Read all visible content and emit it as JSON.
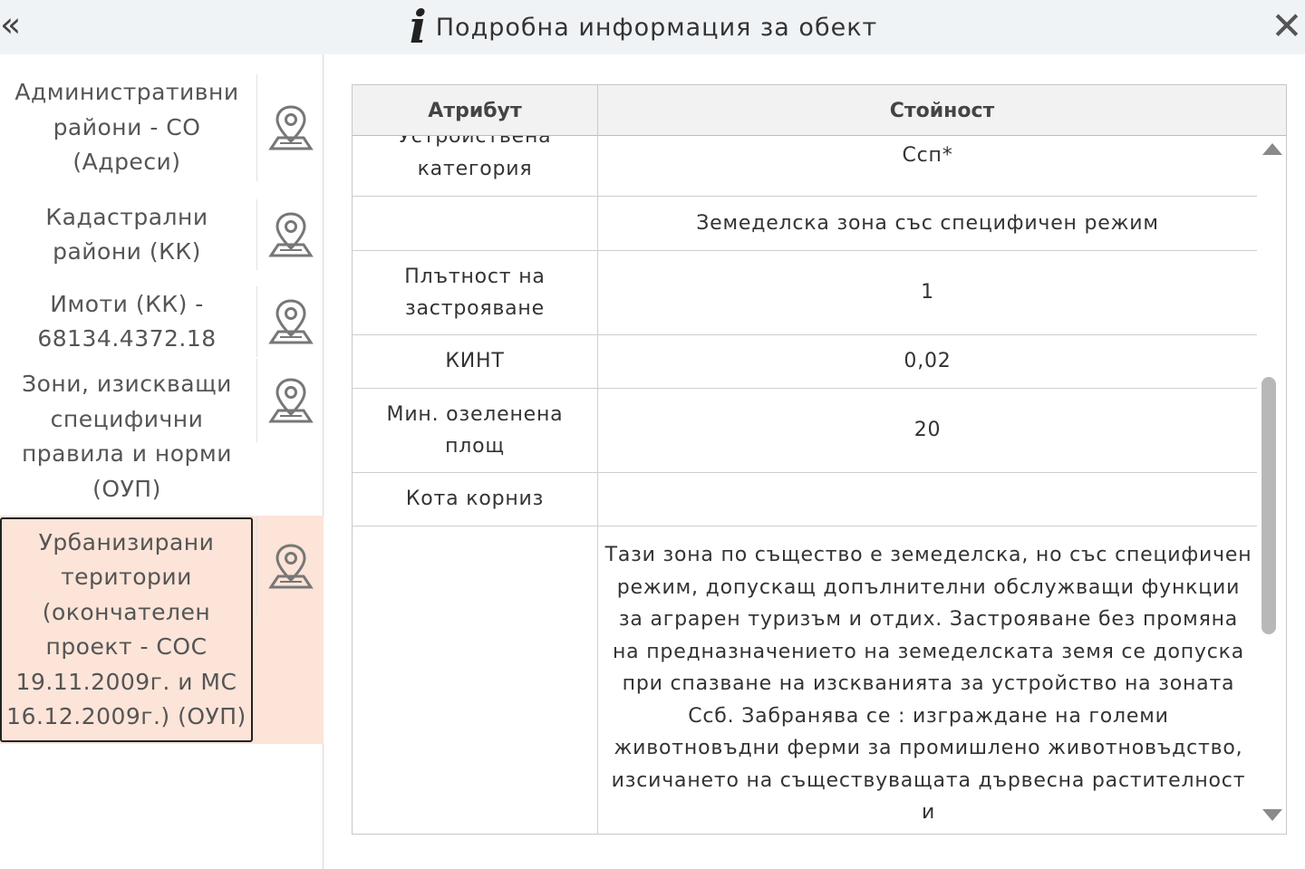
{
  "header": {
    "collapse_glyph": "«",
    "info_glyph": "i",
    "title": "Подробна информация за обект",
    "close_glyph": "✕"
  },
  "layers": [
    {
      "label": "Административни райони - СО (Адреси)",
      "icon": "map-pin-icon",
      "selected": false
    },
    {
      "label": "Кадастрални райони (КК)",
      "icon": "map-pin-icon",
      "selected": false
    },
    {
      "label": "Имоти (КК) - 68134.4372.18",
      "icon": "map-pin-icon",
      "selected": false
    },
    {
      "label": "Зони, изискващи специфични правила и норми (ОУП)",
      "icon": "map-pin-icon",
      "selected": false
    },
    {
      "label": "Урбанизирани територии (окончателен проект - СОС 19.11.2009г. и МС 16.12.2009г.) (ОУП)",
      "icon": "map-pin-icon",
      "selected": true
    }
  ],
  "table": {
    "columns": {
      "attribute": "Атрибут",
      "value": "Стойност"
    },
    "rows": [
      {
        "attribute": "Устройствена категория",
        "value": "Ссп*"
      },
      {
        "attribute": "",
        "value": "Земеделска зона със специфичен режим"
      },
      {
        "attribute": "Плътност на застрояване",
        "value": "1"
      },
      {
        "attribute": "КИНТ",
        "value": "0,02"
      },
      {
        "attribute": "Мин. озеленена площ",
        "value": "20"
      },
      {
        "attribute": "Кота корниз",
        "value": ""
      },
      {
        "attribute": "",
        "value": "Тази зона по същество е земеделска, но със специфичен режим, допускащ допълнителни обслужващи функции за аграрен туризъм и отдих. Застрояване без промяна на предназначението на земеделската земя се допуска при спазване на изскванията за устройство на зоната Ссб. Забранява се : изграждане на големи животновъдни ферми за промишлено животновъдство, изсичането на съществуващата дървесна растителност и"
      }
    ]
  },
  "colors": {
    "selected_bg": "#fce4d8",
    "header_bg": "#f0f3f6"
  }
}
